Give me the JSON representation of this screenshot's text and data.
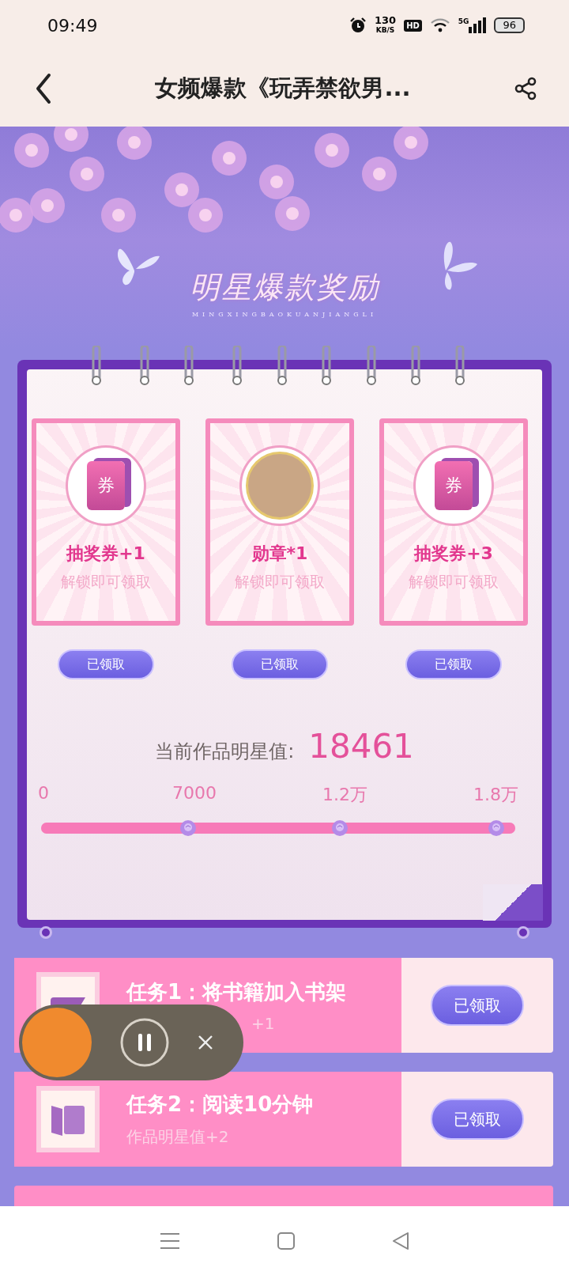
{
  "status_bar": {
    "time": "09:49",
    "speed_value": "130",
    "speed_unit": "KB/S",
    "hd": "HD",
    "network": "5G",
    "battery": "96"
  },
  "nav": {
    "title": "女频爆款《玩弄禁欲男..."
  },
  "banner": {
    "title": "明星爆款奖励",
    "subtitle": "MINGXINGBAOKUANJIANGLI"
  },
  "rewards": [
    {
      "kind": "ticket",
      "icon_text": "券",
      "name": "抽奖券+1",
      "note": "解锁即可领取",
      "button": "已领取"
    },
    {
      "kind": "medal",
      "name": "勋章*1",
      "note": "解锁即可领取",
      "button": "已领取"
    },
    {
      "kind": "ticket",
      "icon_text": "券",
      "name": "抽奖券+3",
      "note": "解锁即可领取",
      "button": "已领取"
    }
  ],
  "star_value": {
    "label": "当前作品明星值:",
    "value": "18461"
  },
  "progress": {
    "ticks": [
      "0",
      "7000",
      "1.2万",
      "1.8万"
    ],
    "level": 1
  },
  "tasks": [
    {
      "kind": "bookmark",
      "title": "任务1：将书籍加入书架",
      "desc": "+1",
      "button": "已领取"
    },
    {
      "kind": "book",
      "title": "任务2：阅读10分钟",
      "desc": "作品明星值+2",
      "button": "已领取"
    }
  ]
}
